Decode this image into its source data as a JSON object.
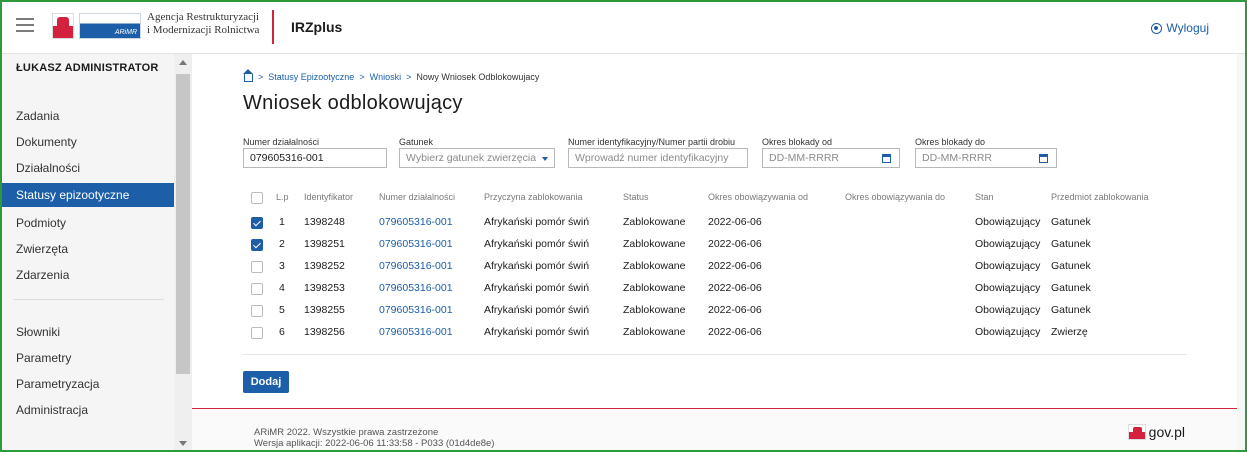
{
  "header": {
    "agency_line1": "Agencja Restrukturyzacji",
    "agency_line2": "i Modernizacji Rolnictwa",
    "arimr_label": "ARiMR",
    "app_name": "IRZplus",
    "logout_label": "Wyloguj"
  },
  "sidebar": {
    "user": "ŁUKASZ ADMINISTRATOR",
    "items": [
      {
        "label": "Zadania"
      },
      {
        "label": "Dokumenty"
      },
      {
        "label": "Działalności"
      },
      {
        "label": "Statusy epizootyczne",
        "active": true
      },
      {
        "label": "Podmioty"
      },
      {
        "label": "Zwierzęta"
      },
      {
        "label": "Zdarzenia"
      }
    ],
    "items2": [
      {
        "label": "Słowniki"
      },
      {
        "label": "Parametry"
      },
      {
        "label": "Parametryzacja"
      },
      {
        "label": "Administracja"
      }
    ]
  },
  "breadcrumb": {
    "items": [
      "Statusy Epizootyczne",
      "Wnioski",
      "Nowy Wniosek Odblokowujacy"
    ],
    "separator": ">"
  },
  "page": {
    "title": "Wniosek odblokowujący"
  },
  "filters": {
    "activity_number": {
      "label": "Numer działalności",
      "value": "079605316-001"
    },
    "species": {
      "label": "Gatunek",
      "placeholder": "Wybierz gatunek zwierzęcia"
    },
    "id_number": {
      "label": "Numer identyfikacyjny/Numer partii drobiu",
      "placeholder": "Wprowadź numer identyfikacyjny"
    },
    "block_from": {
      "label": "Okres blokady od",
      "placeholder": "DD-MM-RRRR"
    },
    "block_to": {
      "label": "Okres blokady do",
      "placeholder": "DD-MM-RRRR"
    }
  },
  "table": {
    "headers": {
      "lp": "L.p",
      "identyfikator": "Identyfikator",
      "numer_dzialalnosci": "Numer działalności",
      "przyczyna": "Przyczyna zablokowania",
      "status": "Status",
      "okres_od": "Okres obowiązywania od",
      "okres_do": "Okres obowiązywania do",
      "stan": "Stan",
      "przedmiot": "Przedmiot zablokowania"
    },
    "rows": [
      {
        "checked": true,
        "lp": "1",
        "id": "1398248",
        "activity": "079605316-001",
        "reason": "Afrykański pomór świń",
        "status": "Zablokowane",
        "from": "2022-06-06",
        "to": "",
        "state": "Obowiązujący",
        "subject": "Gatunek"
      },
      {
        "checked": true,
        "lp": "2",
        "id": "1398251",
        "activity": "079605316-001",
        "reason": "Afrykański pomór świń",
        "status": "Zablokowane",
        "from": "2022-06-06",
        "to": "",
        "state": "Obowiązujący",
        "subject": "Gatunek"
      },
      {
        "checked": false,
        "lp": "3",
        "id": "1398252",
        "activity": "079605316-001",
        "reason": "Afrykański pomór świń",
        "status": "Zablokowane",
        "from": "2022-06-06",
        "to": "",
        "state": "Obowiązujący",
        "subject": "Gatunek"
      },
      {
        "checked": false,
        "lp": "4",
        "id": "1398253",
        "activity": "079605316-001",
        "reason": "Afrykański pomór świń",
        "status": "Zablokowane",
        "from": "2022-06-06",
        "to": "",
        "state": "Obowiązujący",
        "subject": "Gatunek"
      },
      {
        "checked": false,
        "lp": "5",
        "id": "1398255",
        "activity": "079605316-001",
        "reason": "Afrykański pomór świń",
        "status": "Zablokowane",
        "from": "2022-06-06",
        "to": "",
        "state": "Obowiązujący",
        "subject": "Gatunek"
      },
      {
        "checked": false,
        "lp": "6",
        "id": "1398256",
        "activity": "079605316-001",
        "reason": "Afrykański pomór świń",
        "status": "Zablokowane",
        "from": "2022-06-06",
        "to": "",
        "state": "Obowiązujący",
        "subject": "Zwierzę"
      }
    ]
  },
  "actions": {
    "add_label": "Dodaj"
  },
  "footer": {
    "copyright": "ARiMR 2022. Wszystkie prawa zastrzeżone",
    "version": "Wersja aplikacji: 2022-06-06 11:33:58 - P033 (01d4de8e)",
    "gov_label": "gov.pl"
  },
  "colors": {
    "accent": "#1c5ea8",
    "brand_red": "#d4213d",
    "frame_green": "#2f9a3a"
  }
}
